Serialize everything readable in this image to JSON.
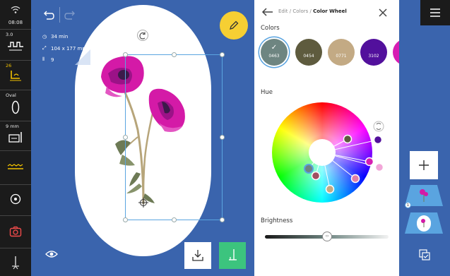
{
  "status": {
    "time": "08:08"
  },
  "left_toolbar": {
    "stitch_length": "3.0",
    "tension": "26",
    "hoop_shape": "Oval",
    "presser_height": "9 mm"
  },
  "design_info": {
    "time": "34 min",
    "size": "104 x 177 mm",
    "colors": "9"
  },
  "panel": {
    "breadcrumb_1": "Edit /",
    "breadcrumb_2": "Colors /",
    "breadcrumb_current": "Color Wheel",
    "colors_title": "Colors",
    "hue_title": "Hue",
    "brightness_title": "Brightness",
    "swatches": [
      {
        "code": "0463",
        "color": "#6e8581",
        "selected": true
      },
      {
        "code": "0454",
        "color": "#5e5b3e",
        "selected": false
      },
      {
        "code": "0771",
        "color": "#c3aa84",
        "selected": false
      },
      {
        "code": "3102",
        "color": "#52109c",
        "selected": false
      },
      {
        "code": "",
        "color": "#d61eb3",
        "selected": false
      }
    ],
    "brightness": 0.5
  },
  "colors": {
    "canvas_bg": "#3a64ad",
    "toolbar_bg": "#1b1b1b",
    "accent_yellow": "#f6cf33",
    "accent_green": "#3cc47e",
    "selection": "#5aa4e0"
  }
}
